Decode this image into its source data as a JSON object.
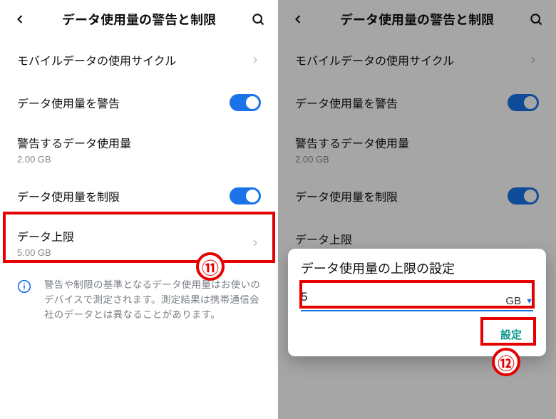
{
  "left": {
    "topbar": {
      "title": "データ使用量の警告と制限"
    },
    "rows": {
      "cycle": {
        "label": "モバイルデータの使用サイクル"
      },
      "warn": {
        "label": "データ使用量を警告"
      },
      "warnAmt": {
        "label": "警告するデータ使用量",
        "sub": "2.00 GB"
      },
      "limit": {
        "label": "データ使用量を制限"
      },
      "cap": {
        "label": "データ上限",
        "sub": "5.00 GB"
      }
    },
    "note": "警告や制限の基準となるデータ使用量はお使いのデバイスで測定されます。測定結果は携帯通信会社のデータとは異なることがあります。",
    "badge": "⑪"
  },
  "right": {
    "topbar": {
      "title": "データ使用量の警告と制限"
    },
    "rows": {
      "cycle": {
        "label": "モバイルデータの使用サイクル"
      },
      "warn": {
        "label": "データ使用量を警告"
      },
      "warnAmt": {
        "label": "警告するデータ使用量",
        "sub": "2.00 GB"
      },
      "limit": {
        "label": "データ使用量を制限"
      },
      "cap": {
        "label": "データ上限"
      }
    },
    "dialog": {
      "title": "データ使用量の上限の設定",
      "value": "5",
      "unit": "GB",
      "confirm": "設定"
    },
    "badge": "⑫"
  }
}
